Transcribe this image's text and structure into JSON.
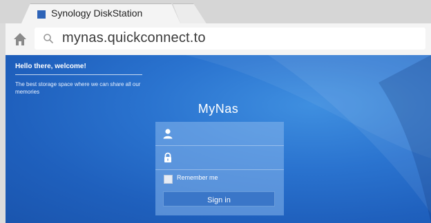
{
  "browser": {
    "tab": {
      "title": "Synology DiskStation",
      "favicon": "synology-favicon"
    },
    "address_bar": {
      "url": "mynas.quickconnect.to",
      "icon": "search-icon"
    },
    "toolbar": {
      "home_icon": "home-icon"
    }
  },
  "page": {
    "welcome": {
      "title": "Hello there, welcome!",
      "subtitle": "The best storage space where we can share all our memories"
    },
    "brand_name": "MyNas",
    "login": {
      "username_icon": "user-icon",
      "password_icon": "lock-icon",
      "remember_label": "Remember me",
      "remember_checked": false,
      "signin_label": "Sign in"
    }
  },
  "colors": {
    "page_background": "#2a73cf",
    "login_panel": "#87b6ec",
    "signin_button": "#3a76c8",
    "favicon": "#2e64b8"
  }
}
